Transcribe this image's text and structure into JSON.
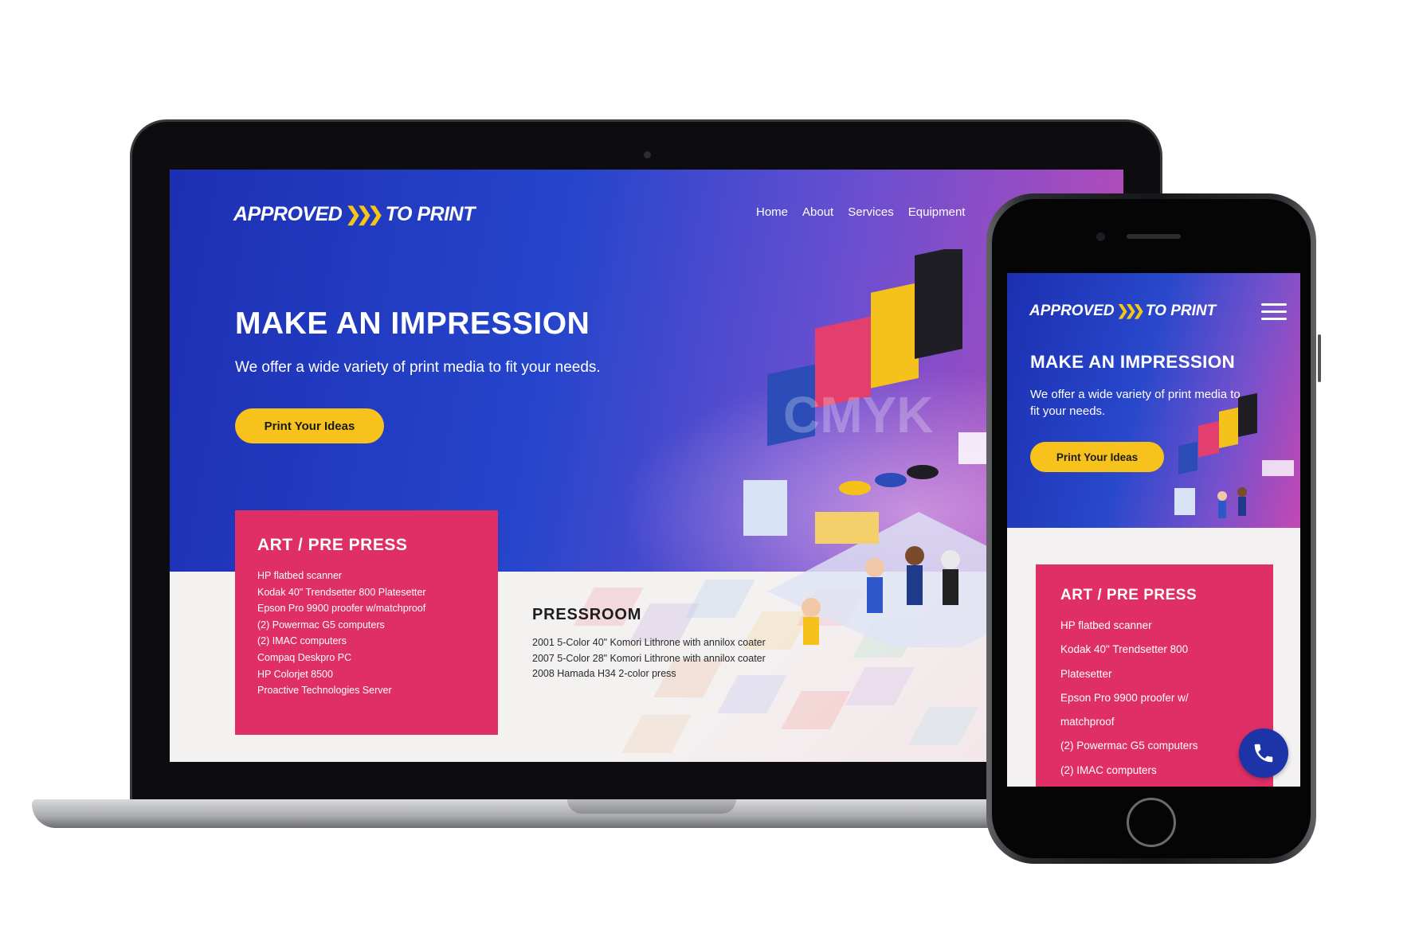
{
  "brand": {
    "logo_left": "APPROVED",
    "logo_right": "TO PRINT",
    "chevrons": "❯❯❯",
    "accent": "#f7c21c",
    "primary_blue": "#1d2fb3",
    "card_pink": "#df2f66"
  },
  "nav": {
    "items": [
      "Home",
      "About",
      "Services",
      "Equipment"
    ]
  },
  "hero": {
    "title": "MAKE AN IMPRESSION",
    "subtitle": "We offer a wide variety of print media to fit your needs.",
    "cta_label": "Print Your Ideas",
    "illustration_text": "CMYK"
  },
  "art_prepress": {
    "heading": "ART / PRE PRESS",
    "items": [
      "HP flatbed scanner",
      "Kodak 40\" Trendsetter 800 Platesetter",
      "Epson Pro 9900 proofer w/matchproof",
      "(2) Powermac G5 computers",
      "(2) IMAC computers",
      "Compaq Deskpro PC",
      "HP Colorjet 8500",
      "Proactive Technologies Server"
    ]
  },
  "pressroom": {
    "heading": "PRESSROOM",
    "items": [
      "2001 5-Color 40\" Komori Lithrone with annilox coater",
      "2007 5-Color 28\" Komori Lithrone with annilox coater",
      "2008 Hamada H34 2-color press"
    ]
  },
  "mobile": {
    "title": "MAKE AN IMPRESSION",
    "subtitle": "We offer a wide variety of print media to fit your needs.",
    "cta_label": "Print Your Ideas",
    "card_heading": "ART / PRE PRESS",
    "card_items": [
      "HP flatbed scanner",
      "Kodak 40\" Trendsetter 800",
      "Platesetter",
      "Epson Pro 9900 proofer w/",
      "matchproof",
      "(2) Powermac G5 computers",
      "(2) IMAC computers"
    ],
    "menu_icon": "hamburger-icon",
    "call_icon": "phone-icon"
  }
}
